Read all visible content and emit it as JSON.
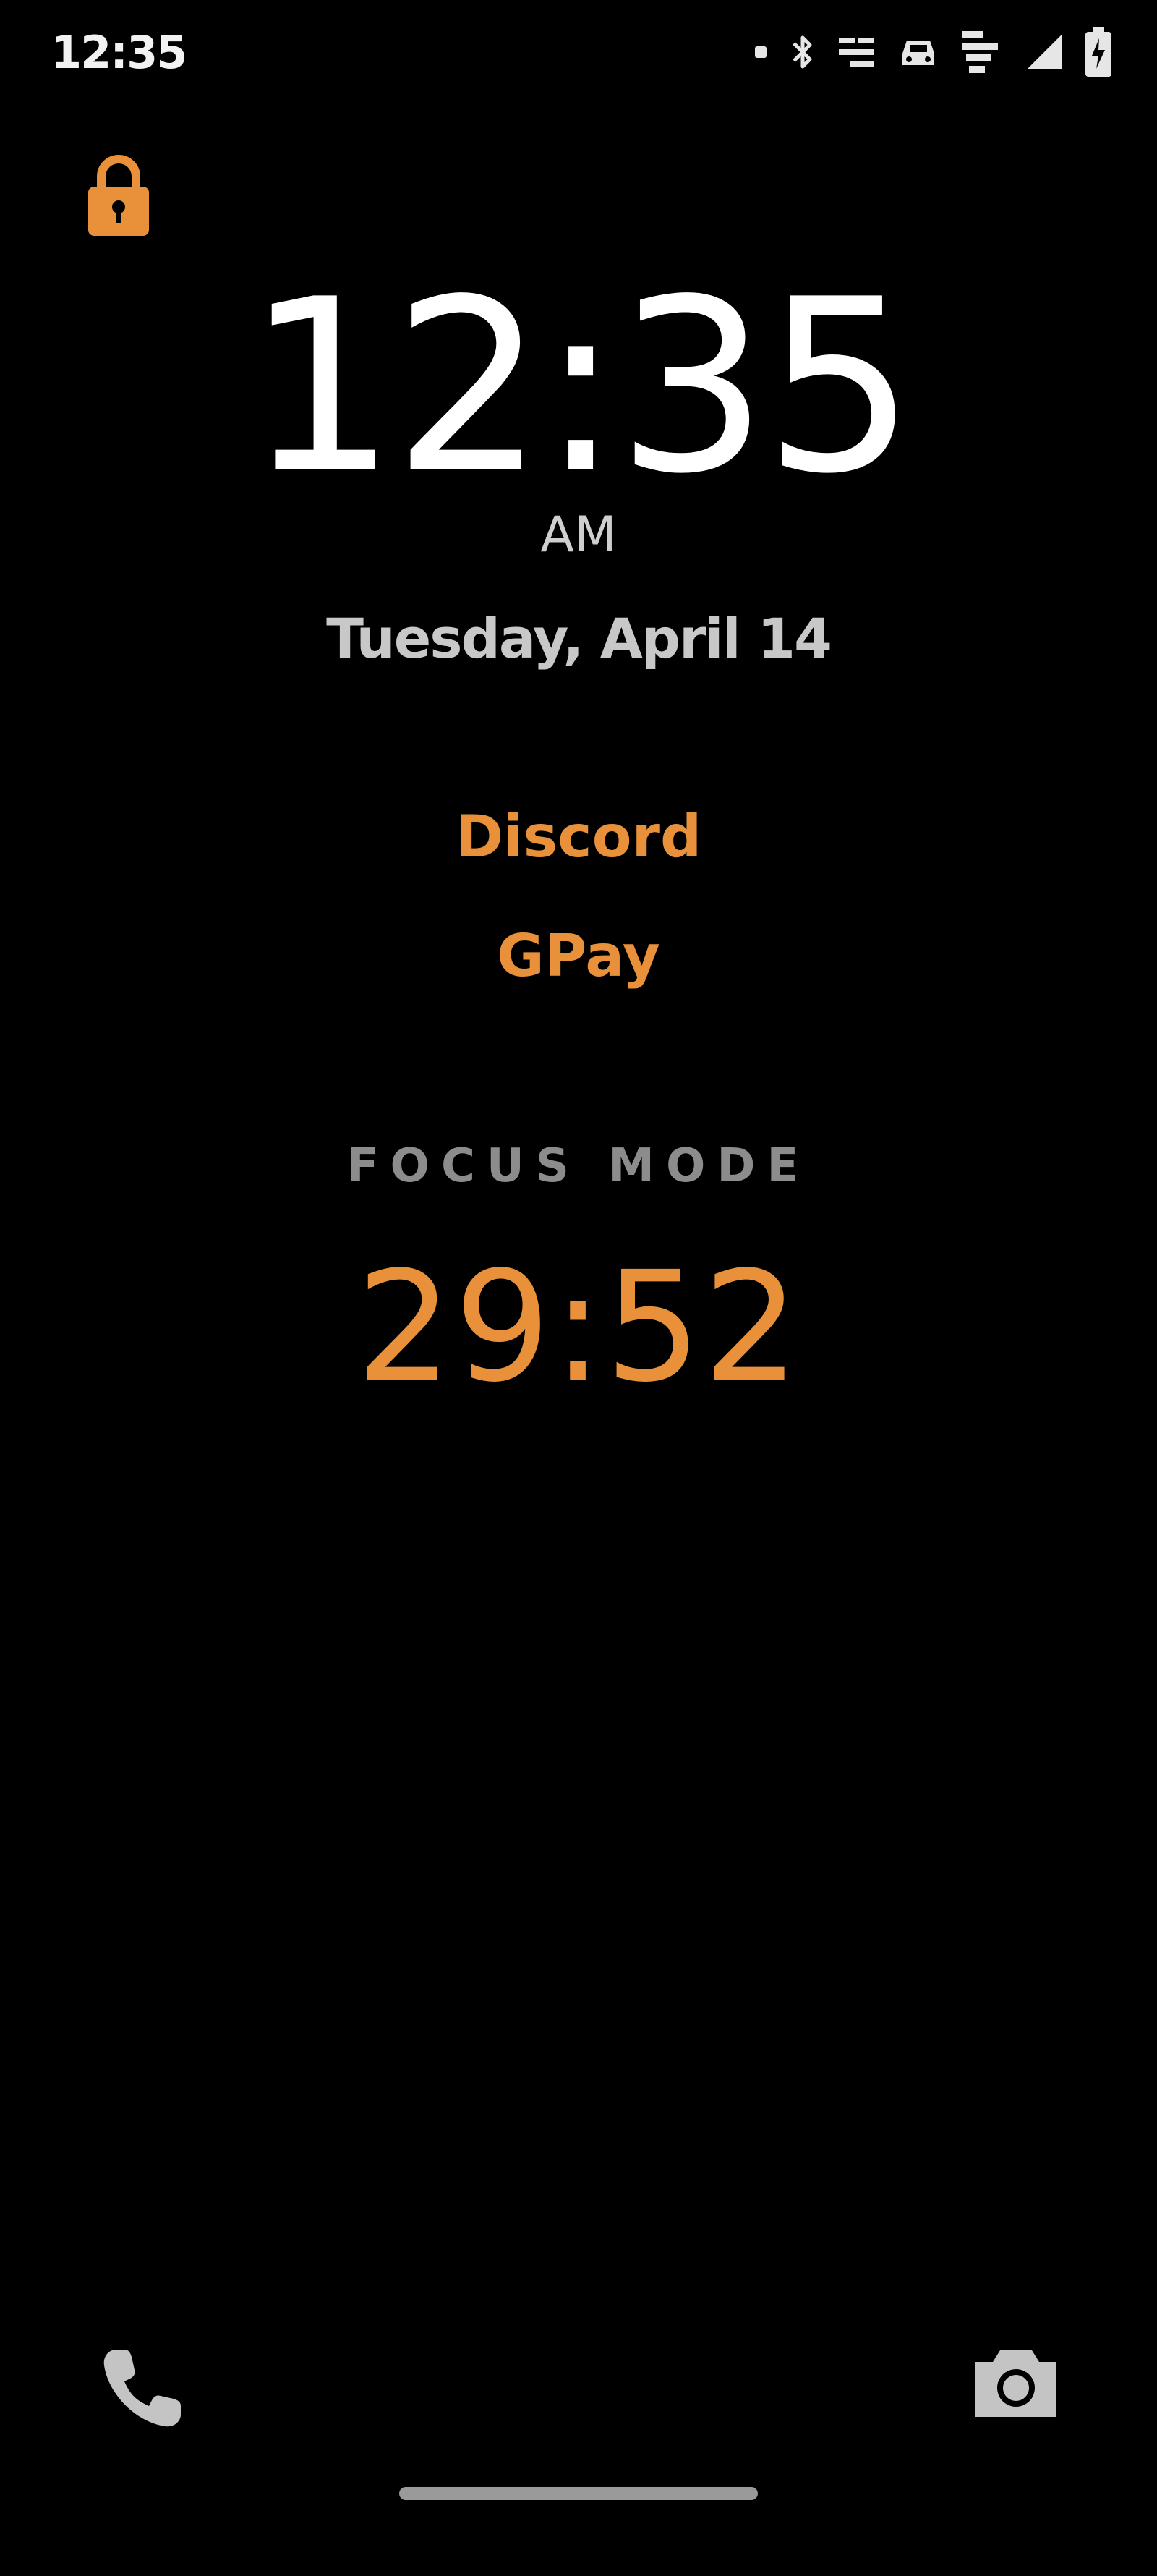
{
  "status_bar": {
    "time": "12:35",
    "icons": [
      "notification-dot-icon",
      "bluetooth-icon",
      "nfc-icon",
      "car-icon",
      "data-icon",
      "signal-icon",
      "battery-icon"
    ]
  },
  "lock": {
    "icon": "lock-icon",
    "color": "#e8913a"
  },
  "clock": {
    "time": "12:35",
    "ampm": "AM",
    "date": "Tuesday, April 14"
  },
  "favorite_apps": [
    {
      "label": "Discord"
    },
    {
      "label": "GPay"
    }
  ],
  "focus_mode": {
    "title": "FOCUS MODE",
    "timer": "29:52"
  },
  "bottom_shortcuts": {
    "left_icon": "phone-icon",
    "right_icon": "camera-icon"
  },
  "colors": {
    "accent": "#e8913a",
    "background": "#000000",
    "text_primary": "#ffffff",
    "text_secondary": "#c8c8c8"
  }
}
